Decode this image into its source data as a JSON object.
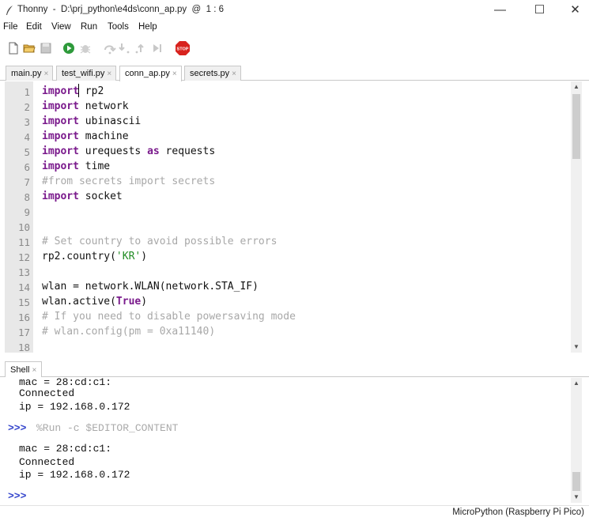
{
  "window": {
    "title": "Thonny  -  D:\\prj_python\\e4ds\\conn_ap.py  @  1 : 6",
    "minimize": "—",
    "maximize": "☐",
    "close": "✕"
  },
  "menu": [
    "File",
    "Edit",
    "View",
    "Run",
    "Tools",
    "Help"
  ],
  "toolbar": [
    {
      "icon": "new-file-icon",
      "enabled": true
    },
    {
      "icon": "open-folder-icon",
      "enabled": true
    },
    {
      "icon": "save-icon",
      "enabled": false
    },
    {
      "icon": "run-icon",
      "enabled": true
    },
    {
      "icon": "debug-icon",
      "enabled": false
    },
    {
      "icon": "step-over-icon",
      "enabled": false
    },
    {
      "icon": "step-into-icon",
      "enabled": false
    },
    {
      "icon": "step-out-icon",
      "enabled": false
    },
    {
      "icon": "resume-icon",
      "enabled": false
    },
    {
      "icon": "stop-icon",
      "enabled": true,
      "label": "STOP"
    }
  ],
  "tabs": [
    {
      "label": "main.py",
      "close": "×",
      "active": false
    },
    {
      "label": "test_wifi.py",
      "close": "×",
      "active": false
    },
    {
      "label": "conn_ap.py",
      "close": "×",
      "active": true
    },
    {
      "label": "secrets.py",
      "close": "×",
      "active": false
    }
  ],
  "editor": {
    "line_numbers": [
      "1",
      "2",
      "3",
      "4",
      "5",
      "6",
      "7",
      "8",
      "9",
      "10",
      "11",
      "12",
      "13",
      "14",
      "15",
      "16",
      "17",
      "18"
    ],
    "lines": [
      [
        {
          "t": "import",
          "c": "kw"
        },
        {
          "t": " rp2"
        }
      ],
      [
        {
          "t": "import",
          "c": "kw"
        },
        {
          "t": " network"
        }
      ],
      [
        {
          "t": "import",
          "c": "kw"
        },
        {
          "t": " ubinascii"
        }
      ],
      [
        {
          "t": "import",
          "c": "kw"
        },
        {
          "t": " machine"
        }
      ],
      [
        {
          "t": "import",
          "c": "kw"
        },
        {
          "t": " urequests "
        },
        {
          "t": "as",
          "c": "kw"
        },
        {
          "t": " requests"
        }
      ],
      [
        {
          "t": "import",
          "c": "kw"
        },
        {
          "t": " time"
        }
      ],
      [
        {
          "t": "#from secrets import secrets",
          "c": "cm"
        }
      ],
      [
        {
          "t": "import",
          "c": "kw"
        },
        {
          "t": " socket"
        }
      ],
      [],
      [],
      [
        {
          "t": "# Set country to avoid possible errors",
          "c": "cm"
        }
      ],
      [
        {
          "t": "rp2.country("
        },
        {
          "t": "'KR'",
          "c": "st"
        },
        {
          "t": ")"
        }
      ],
      [],
      [
        {
          "t": "wlan = network.WLAN(network.STA_IF)"
        }
      ],
      [
        {
          "t": "wlan.active("
        },
        {
          "t": "True",
          "c": "kw"
        },
        {
          "t": ")"
        }
      ],
      [
        {
          "t": "# If you need to disable powersaving mode",
          "c": "cm"
        }
      ],
      [
        {
          "t": "# wlan.config(pm = 0xa11140)",
          "c": "cm"
        }
      ],
      []
    ]
  },
  "shell": {
    "tab_label": "Shell",
    "tab_close": "×",
    "prompt": ">>>",
    "output_1": [
      "mac = 28:cd:c1:",
      "Connected",
      "ip = 192.168.0.172"
    ],
    "command": "%Run -c $EDITOR_CONTENT",
    "output_2": [
      "mac = 28:cd:c1:",
      "Connected",
      "ip = 192.168.0.172"
    ]
  },
  "status": {
    "interpreter": "MicroPython (Raspberry Pi Pico)"
  },
  "colors": {
    "keyword": "#7a1a8c",
    "comment": "#a8a8a8",
    "string": "#1f8b22",
    "prompt": "#3344cc",
    "gutter": "#e8e8e8"
  }
}
